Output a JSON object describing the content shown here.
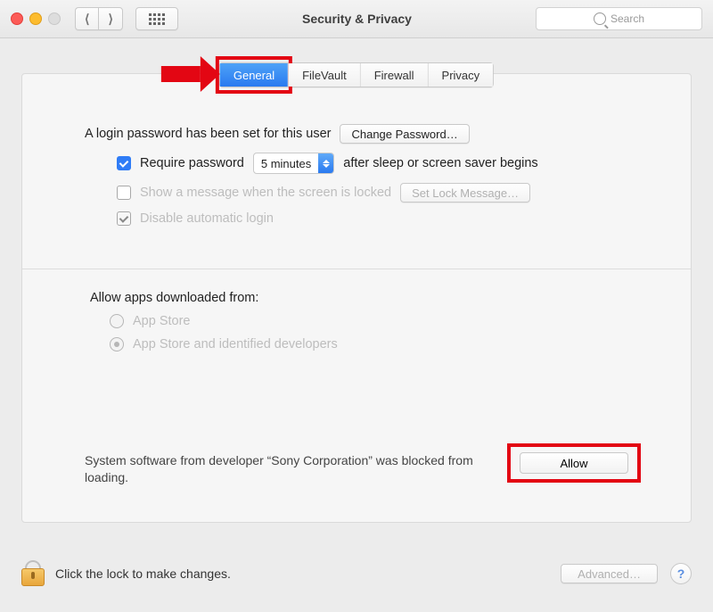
{
  "window": {
    "title": "Security & Privacy",
    "search_placeholder": "Search"
  },
  "tabs": {
    "general": "General",
    "filevault": "FileVault",
    "firewall": "Firewall",
    "privacy": "Privacy",
    "active": "general"
  },
  "general": {
    "login_password_text": "A login password has been set for this user",
    "change_password_btn": "Change Password…",
    "require_password_label": "Require password",
    "require_password_checked": true,
    "require_delay_value": "5 minutes",
    "require_delay_suffix": "after sleep or screen saver begins",
    "show_message_label": "Show a message when the screen is locked",
    "show_message_checked": false,
    "set_lock_message_btn": "Set Lock Message…",
    "disable_auto_login_label": "Disable automatic login",
    "disable_auto_login_checked": true,
    "allow_apps_label": "Allow apps downloaded from:",
    "allow_apps_options": {
      "app_store": "App Store",
      "identified": "App Store and identified developers"
    },
    "allow_apps_selected": "identified",
    "blocked_text": "System software from developer “Sony Corporation” was blocked from loading.",
    "allow_btn": "Allow"
  },
  "footer": {
    "lock_text": "Click the lock to make changes.",
    "advanced_btn": "Advanced…",
    "help": "?"
  }
}
